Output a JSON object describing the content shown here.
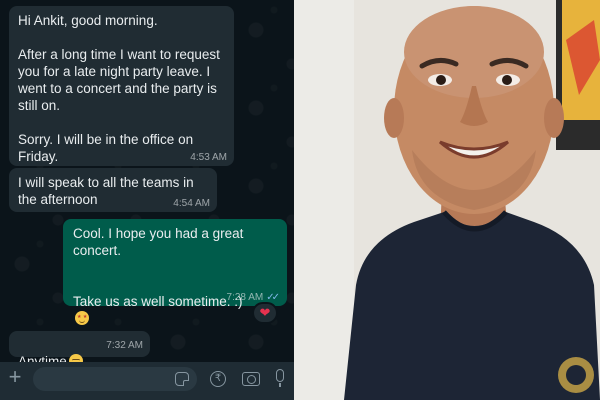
{
  "chat": {
    "messages": [
      {
        "direction": "incoming",
        "text": "Hi Ankit, good morning.\n\nAfter a long time I want to request you for a late night party leave. I went to a concert and the party is still on.\n\nSorry. I will be in the office on Friday.",
        "time": "4:53 AM"
      },
      {
        "direction": "incoming",
        "text": "I will speak to all the teams in the afternoon",
        "time": "4:54 AM"
      },
      {
        "direction": "outgoing",
        "text_line1": "Cool. I hope you had a great concert.",
        "text_line2": "Take us as well sometime. :)",
        "emoji": "star-struck-emoji",
        "time": "7:28 AM",
        "status": "read",
        "reaction": "red-heart"
      },
      {
        "direction": "incoming",
        "text": "Anytime",
        "emoji": "relieved-face-emoji",
        "time": "7:32 AM"
      }
    ],
    "theme": {
      "background": "#0b141a",
      "incoming_bubble": "#202c33",
      "outgoing_bubble": "#005c4b",
      "read_ticks": "#7fb8e8",
      "composer": "#1f2c34"
    }
  },
  "composer": {
    "icons": [
      "plus-icon",
      "sticker-icon",
      "rupee-payment-icon",
      "camera-icon",
      "microphone-icon"
    ]
  },
  "photo": {
    "subject": "smiling-man-in-navy-tshirt"
  }
}
